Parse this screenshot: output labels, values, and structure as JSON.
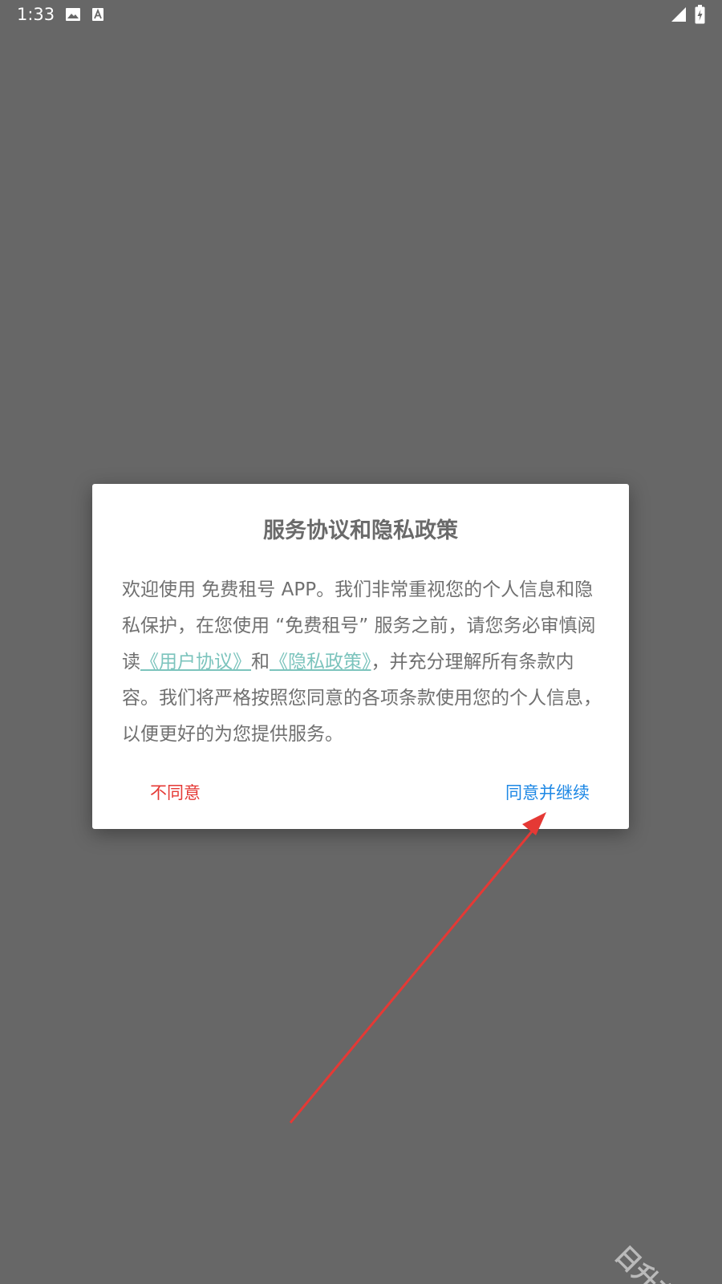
{
  "status_bar": {
    "time": "1:33",
    "icons": [
      "image-icon",
      "a-font-icon",
      "signal-icon",
      "battery-charging-icon"
    ]
  },
  "dialog": {
    "title": "服务协议和隐私政策",
    "body": {
      "line1": "欢迎使用 免费租号 APP。我们非常重视您的个人信息和隐私保护，在您使用 “免费租号” 服务之前，请您务必审慎阅读",
      "link_user_agreement": "《用户协议》",
      "conj": "和",
      "link_privacy_policy": "《隐私政策》",
      "line2": "，并充分理解所有条款内容。我们将严格按照您同意的各项条款使用您的个人信息，以便更好的为您提供服务。"
    },
    "buttons": {
      "disagree": "不同意",
      "agree": "同意并继续"
    }
  },
  "annotation": {
    "arrow_color": "#e53935"
  },
  "watermark": "日升在线",
  "colors": {
    "overlay": "#676767",
    "disagree": "#e53935",
    "agree": "#1e88e5",
    "link": "#7cc4bd"
  }
}
